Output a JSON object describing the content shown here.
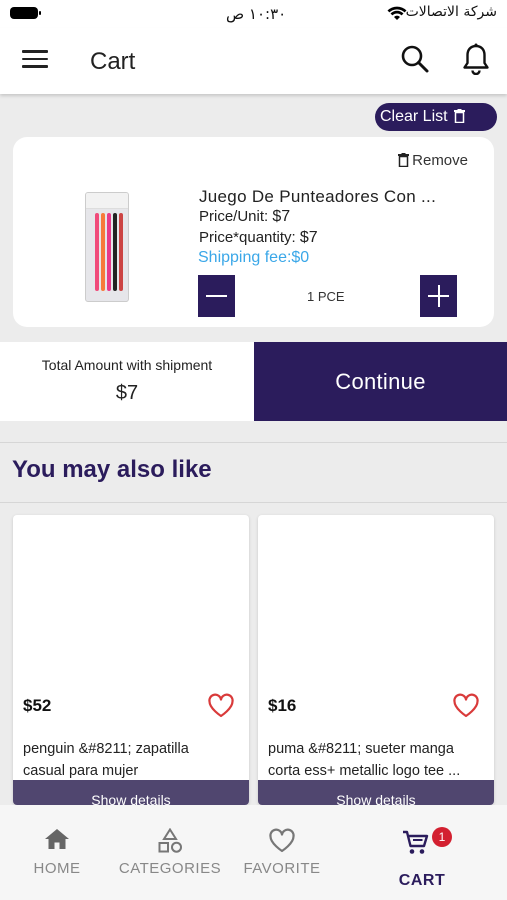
{
  "status_bar": {
    "time": "١٠:٣٠ ص",
    "carrier": "شركة الاتصالات"
  },
  "header": {
    "title": "Cart"
  },
  "cart": {
    "clear_label": "Clear List",
    "item": {
      "remove_label": "Remove",
      "name": "Juego De Punteadores Con ...",
      "price_unit_label": "Price/Unit:",
      "price_unit_value": "$7",
      "price_qty_label": "Price*quantity:",
      "price_qty_value": "$7",
      "shipping_label": "Shipping fee:",
      "shipping_value": "$0",
      "quantity": "1 PCE"
    },
    "total_label": "Total Amount with shipment",
    "total_value": "$7",
    "continue_label": "Continue"
  },
  "recommend": {
    "heading": "You may also like",
    "products": [
      {
        "price": "$52",
        "line1": "penguin &#8211; zapatilla",
        "line2": "casual para mujer",
        "button": "Show details"
      },
      {
        "price": "$16",
        "line1": "puma &#8211; sueter manga",
        "line2": "corta ess+ metallic logo tee ...",
        "button": "Show details"
      }
    ]
  },
  "bottom_nav": {
    "items": [
      {
        "label": "HOME",
        "icon": "home-icon"
      },
      {
        "label": "CATEGORIES",
        "icon": "categories-icon"
      },
      {
        "label": "FAVORITE",
        "icon": "heart-icon"
      },
      {
        "label": "CART",
        "icon": "cart-icon"
      }
    ],
    "cart_badge": "1",
    "active_index": 3
  },
  "colors": {
    "brand": "#2b1c5c",
    "shipping_link": "#3aa7e8",
    "heart": "#d93a3a",
    "badge": "#d32030"
  }
}
